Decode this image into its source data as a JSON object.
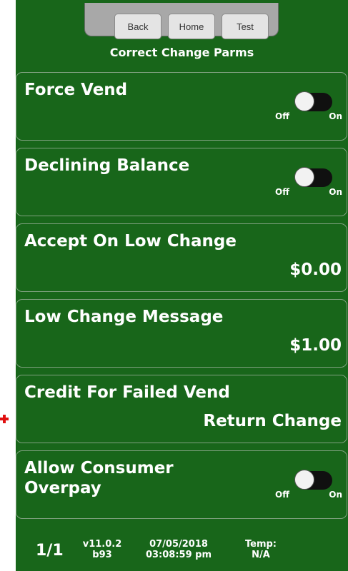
{
  "nav": {
    "back": "Back",
    "home": "Home",
    "test": "Test"
  },
  "title": "Correct Change Parms",
  "rows": [
    {
      "label": "Force Vend",
      "toggle": {
        "off": "Off",
        "on": "On",
        "state": "off"
      }
    },
    {
      "label": "Declining Balance",
      "toggle": {
        "off": "Off",
        "on": "On",
        "state": "off"
      }
    },
    {
      "label": "Accept On Low Change",
      "value": "$0.00"
    },
    {
      "label": "Low Change Message",
      "value": "$1.00"
    },
    {
      "label": "Credit For Failed Vend",
      "value": "Return Change"
    },
    {
      "label": "Allow Consumer\nOverpay",
      "toggle": {
        "off": "Off",
        "on": "On",
        "state": "off"
      }
    }
  ],
  "footer": {
    "page": "1/1",
    "version": "v11.0.2",
    "build": "b93",
    "date": "07/05/2018",
    "time": "03:08:59 pm",
    "temp_label": "Temp:",
    "temp_value": "N/A"
  },
  "colors": {
    "background": "#18661a",
    "knob": "#f2f2f2",
    "marker": "#e01010"
  }
}
